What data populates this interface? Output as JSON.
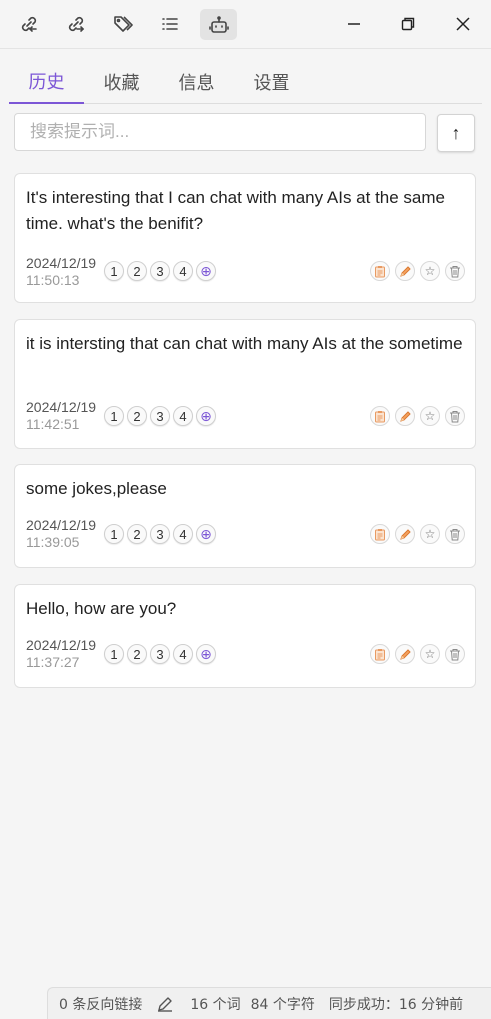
{
  "toolbar": {
    "icons": [
      "backlink-icon",
      "outgoing-link-icon",
      "tags-icon",
      "outline-list-icon",
      "robot-icon"
    ],
    "active_icon": "robot-icon"
  },
  "tabs": [
    {
      "label": "历史",
      "active": true
    },
    {
      "label": "收藏",
      "active": false
    },
    {
      "label": "信息",
      "active": false
    },
    {
      "label": "设置",
      "active": false
    }
  ],
  "search": {
    "placeholder": "搜索提示词..."
  },
  "upload_label": "↑",
  "history": [
    {
      "text": "It's interesting that I can chat with many AIs at the same time. what's the benifit?",
      "date": "2024/12/19",
      "time": "11:50:13"
    },
    {
      "text": "it is intersting that can chat with many AIs at the sometime",
      "date": "2024/12/19",
      "time": "11:42:51"
    },
    {
      "text": "some jokes,please",
      "date": "2024/12/19",
      "time": "11:39:05"
    },
    {
      "text": "Hello, how are you?",
      "date": "2024/12/19",
      "time": "11:37:27"
    }
  ],
  "model_numbers": [
    "1",
    "2",
    "3",
    "4"
  ],
  "add_model_label": "⊕",
  "status_bar": {
    "backlinks": "0 条反向链接",
    "words": "16 个词",
    "chars": "84 个字符",
    "sync": "同步成功：16 分钟前"
  },
  "colors": {
    "accent": "#7c56d6",
    "copy_icon": "#f0a070",
    "edit_icon": "#e8824a"
  }
}
